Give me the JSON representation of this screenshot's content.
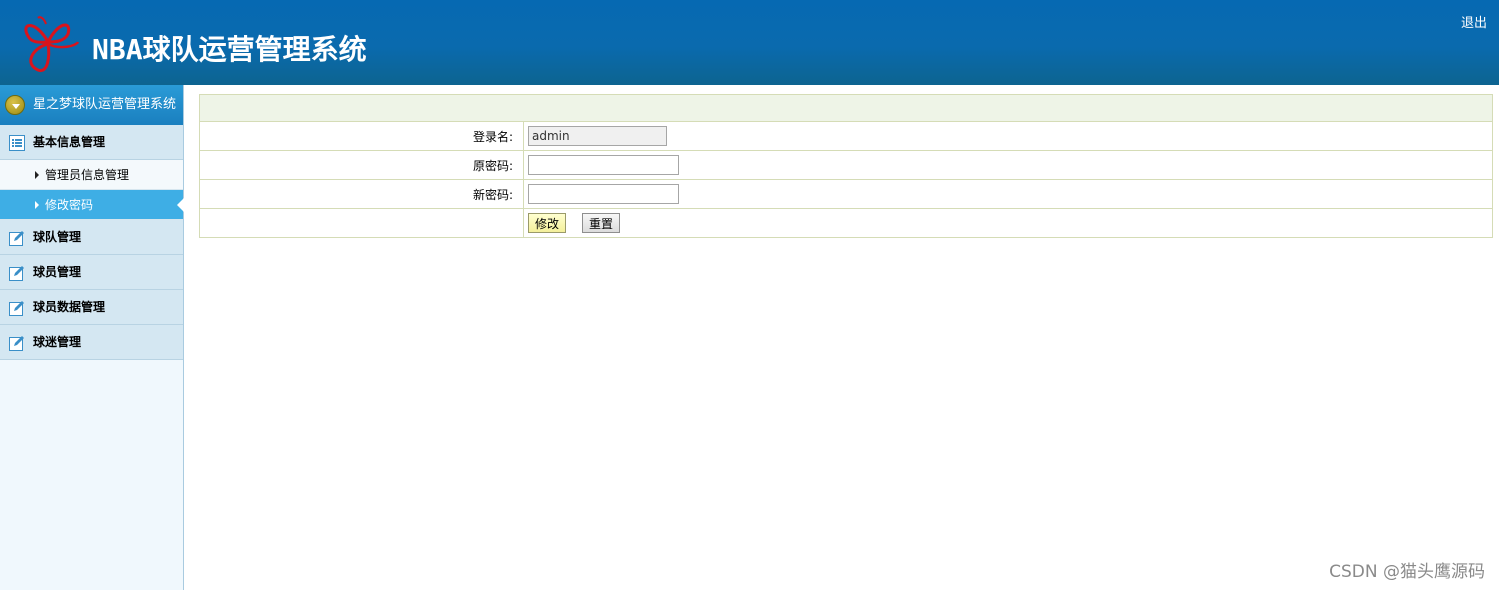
{
  "header": {
    "title": "NBA球队运营管理系统",
    "logout_label": "退出",
    "logo_icon": "butterfly-logo-icon",
    "colors": {
      "background": "#0669b2",
      "logo": "#d8141d"
    }
  },
  "sidebar": {
    "top_title": "星之梦球队运营管理系统",
    "groups": [
      {
        "label": "基本信息管理",
        "icon": "list-icon",
        "expanded": true,
        "items": [
          {
            "label": "管理员信息管理",
            "active": false
          },
          {
            "label": "修改密码",
            "active": true
          }
        ]
      },
      {
        "label": "球队管理",
        "icon": "edit-icon"
      },
      {
        "label": "球员管理",
        "icon": "edit-icon"
      },
      {
        "label": "球员数据管理",
        "icon": "edit-icon"
      },
      {
        "label": "球迷管理",
        "icon": "edit-icon"
      }
    ],
    "colors": {
      "active": "#3eaee5",
      "group_bg": "#d4e7f2"
    }
  },
  "form": {
    "login_name_label": "登录名:",
    "login_name_value": "admin",
    "old_password_label": "原密码:",
    "new_password_label": "新密码:",
    "submit_label": "修改",
    "reset_label": "重置"
  },
  "watermark": "CSDN @猫头鹰源码"
}
